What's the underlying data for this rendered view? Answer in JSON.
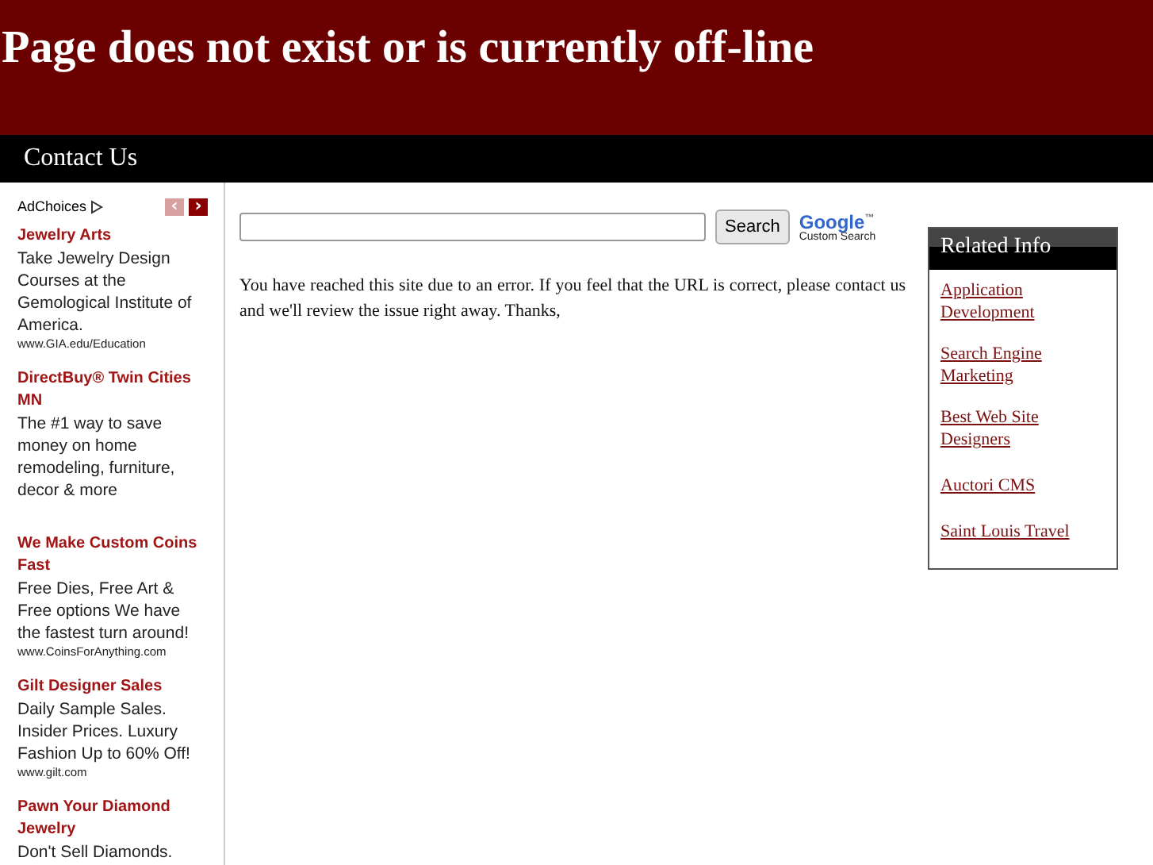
{
  "header": {
    "title": "Page does not exist or is currently off-line"
  },
  "nav": {
    "items": [
      "Contact Us"
    ]
  },
  "ads": {
    "label": "AdChoices",
    "prev_icon": "‹",
    "next_icon": "›",
    "items": [
      {
        "title": "Jewelry Arts",
        "text": "Take Jewelry Design Courses at the Gemological Institute of America.",
        "url": "www.GIA.edu/Education"
      },
      {
        "title": "DirectBuy® Twin Cities MN",
        "text": "The #1 way to save money on home remodeling, furniture, decor & more"
      },
      {
        "title": "We Make Custom Coins Fast",
        "text": "Free Dies, Free Art & Free options We have the fastest turn around!",
        "url": "www.CoinsForAnything.com"
      },
      {
        "title": "Gilt Designer Sales",
        "text": "Daily Sample Sales. Insider Prices. Luxury Fashion Up to 60% Off!",
        "url": "www.gilt.com"
      },
      {
        "title": "Pawn Your Diamond Jewelry",
        "text": "Don't Sell Diamonds."
      }
    ]
  },
  "search": {
    "button": "Search",
    "brand": "Google",
    "brand_mark": "™",
    "brand_sub": "Custom Search"
  },
  "message": "You have reached this site due to an error. If you feel that the URL is correct, please contact us and we'll review the issue right away. Thanks,",
  "related": {
    "title": "Related Info",
    "links": [
      "Application Development",
      "Search Engine Marketing",
      "Best Web Site Designers",
      "Auctori CMS",
      "Saint Louis Travel"
    ]
  }
}
